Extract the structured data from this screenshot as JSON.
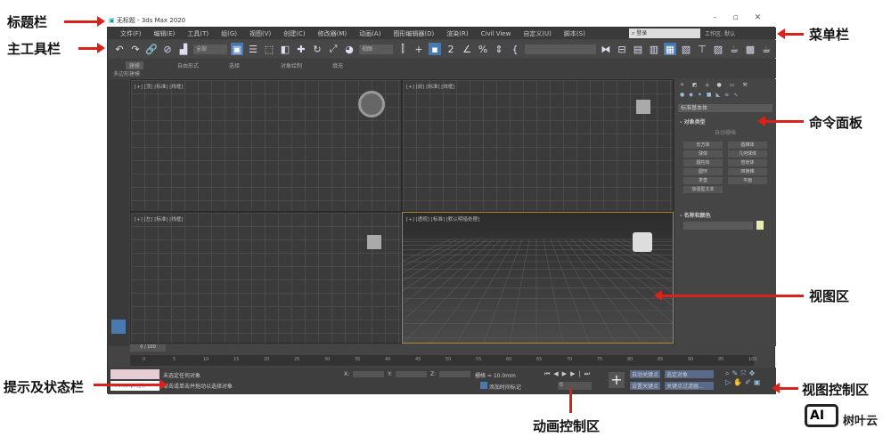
{
  "window": {
    "title": "无标题 - 3ds Max 2020"
  },
  "menu": [
    "文件(F)",
    "编辑(E)",
    "工具(T)",
    "组(G)",
    "视图(V)",
    "创建(C)",
    "修改器(M)",
    "动画(A)",
    "图形编辑器(D)",
    "渲染(R)",
    "Civil View",
    "自定义(U)",
    "脚本(S)"
  ],
  "menu_right": {
    "search": "登录",
    "workspace_label": "工作区:",
    "workspace": "默认"
  },
  "toolbar": {
    "filter": "全部",
    "ref_coord": "视图"
  },
  "ribbon": {
    "tabs": [
      "建模",
      "自由形式",
      "选择",
      "对象绘制",
      "填充"
    ],
    "sub": "多边形建模"
  },
  "viewports": [
    {
      "label": "[+] [顶] [标准] [线框]"
    },
    {
      "label": "[+] [前] [标准] [线框]"
    },
    {
      "label": "[+] [左] [标准] [线框]"
    },
    {
      "label": "[+] [透视] [标准] [默认明暗处理]"
    }
  ],
  "command_panel": {
    "dropdown": "标准基本体",
    "rollout1": "对象类型",
    "autogrid": "自动栅格",
    "buttons": [
      "长方体",
      "圆锥体",
      "球体",
      "几何球体",
      "圆柱体",
      "管状体",
      "圆环",
      "四棱锥",
      "茶壶",
      "平面",
      "加强型文本"
    ],
    "rollout2": "名称和颜色"
  },
  "timeline": {
    "frame": "0 / 100",
    "ticks": [
      "0",
      "5",
      "10",
      "15",
      "20",
      "25",
      "30",
      "35",
      "40",
      "45",
      "50",
      "55",
      "60",
      "65",
      "70",
      "75",
      "80",
      "85",
      "90",
      "95",
      "100"
    ]
  },
  "status": {
    "script": "MAXScript 迷你",
    "line1": "未选定任何对象",
    "line2": "单击或单击并拖动以选择对象",
    "x": "X:",
    "y": "Y:",
    "z": "Z:",
    "grid": "栅格 = 10.0mm",
    "add_tag": "添加时间标记",
    "frame": "0"
  },
  "anim": {
    "auto_key": "自动关键点",
    "set_key": "设置关键点",
    "selected": "选定对象",
    "key_filter": "关键点过滤器..."
  },
  "annotations": {
    "title_bar": "标题栏",
    "main_toolbar": "主工具栏",
    "status_bar": "提示及状态栏",
    "menu_bar": "菜单栏",
    "command_panel": "命令面板",
    "viewport_area": "视图区",
    "viewport_control": "视图控制区",
    "anim_control": "动画控制区"
  },
  "watermark": {
    "logo": "AI",
    "text": "树叶云"
  }
}
